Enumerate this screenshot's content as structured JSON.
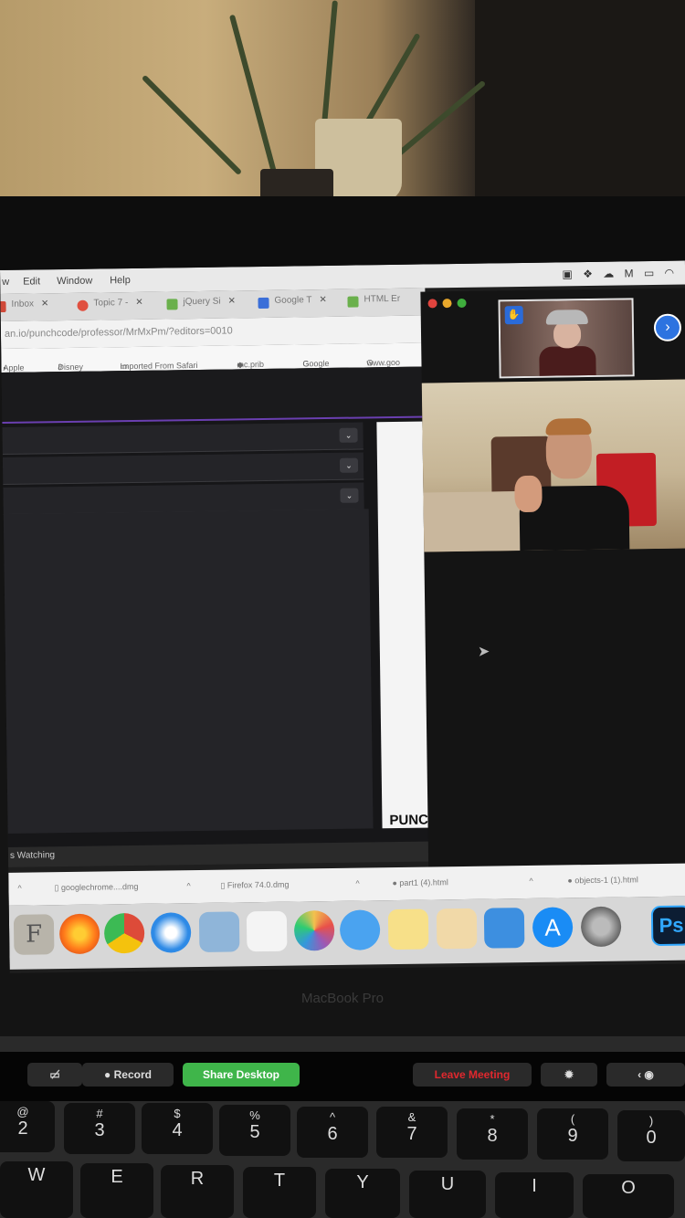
{
  "menubar": {
    "items": [
      "w",
      "Edit",
      "Window",
      "Help"
    ]
  },
  "browser": {
    "tabs": [
      {
        "label": "Inbox",
        "color": "#d04a3a"
      },
      {
        "label": "Topic 7 -",
        "color": "#e05040"
      },
      {
        "label": "jQuery Si",
        "color": "#6ab04c"
      },
      {
        "label": "Google T",
        "color": "#3b6fd8"
      },
      {
        "label": "HTML Er",
        "color": "#6ab04c"
      }
    ],
    "url": "an.io/punchcode/professor/MrMxPm/?editors=0010",
    "bookmarks": [
      "Apple",
      "Disney",
      "Imported From Safari",
      "mc.prib",
      "Google",
      "www.goo"
    ]
  },
  "editor": {
    "preview_text": "PUNC",
    "watching_text": "s Watching"
  },
  "downloads": [
    "googlechrome....dmg",
    "Firefox 74.0.dmg",
    "part1 (4).html",
    "objects-1 (1).html"
  ],
  "dock": {
    "icons": [
      {
        "name": "font-book-icon",
        "color": "#b8b4aa"
      },
      {
        "name": "firefox-icon",
        "color": "#ff7a1a"
      },
      {
        "name": "chrome-icon",
        "color": "#dd4b39"
      },
      {
        "name": "safari-icon",
        "color": "#2e8ae6"
      },
      {
        "name": "preview-icon",
        "color": "#8fb5d9"
      },
      {
        "name": "reminders-icon",
        "color": "#f4f4f4"
      },
      {
        "name": "photos-icon",
        "color": "#f2c14e"
      },
      {
        "name": "messages-icon",
        "color": "#4aa3f0"
      },
      {
        "name": "notes-icon",
        "color": "#f7e089"
      },
      {
        "name": "textedit-icon",
        "color": "#f1d9a8"
      },
      {
        "name": "keynote-icon",
        "color": "#3d8fe0"
      },
      {
        "name": "app-store-icon",
        "color": "#1a8cf5"
      },
      {
        "name": "system-preferences-icon",
        "color": "#8a8a8a"
      },
      {
        "name": "photoshop-icon",
        "color": "#0c1d33"
      }
    ],
    "photoshop_label": "Ps"
  },
  "brand": "MacBook Pro",
  "touchbar": {
    "record": "Record",
    "share": "Share Desktop",
    "leave": "Leave Meeting"
  },
  "keys": [
    {
      "top": "@",
      "bot": "2"
    },
    {
      "top": "#",
      "bot": "3"
    },
    {
      "top": "$",
      "bot": "4"
    },
    {
      "top": "%",
      "bot": "5"
    },
    {
      "top": "^",
      "bot": "6"
    },
    {
      "top": "&",
      "bot": "7"
    },
    {
      "top": "*",
      "bot": "8"
    },
    {
      "top": "(",
      "bot": "9"
    },
    {
      "top": ")",
      "bot": "0"
    },
    {
      "top": "",
      "bot": "W"
    },
    {
      "top": "",
      "bot": "E"
    },
    {
      "top": "",
      "bot": "R"
    },
    {
      "top": "",
      "bot": "T"
    },
    {
      "top": "",
      "bot": "Y"
    },
    {
      "top": "",
      "bot": "U"
    },
    {
      "top": "",
      "bot": "I"
    },
    {
      "top": "",
      "bot": "O"
    }
  ],
  "colors": {
    "zoom_blue": "#2d73e0",
    "share_green": "#3fb54a",
    "leave_red": "#e0282e",
    "editor_purple": "#6a3fb0"
  }
}
